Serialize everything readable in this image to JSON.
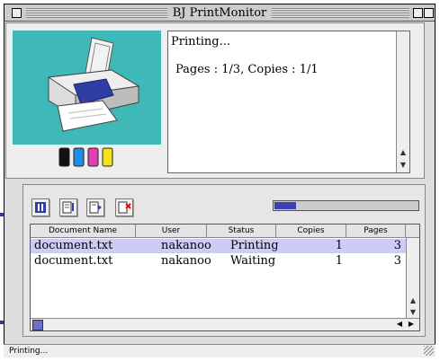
{
  "window": {
    "title": "BJ PrintMonitor"
  },
  "info": {
    "status": "Printing...",
    "detail": "Pages : 1/3, Copies : 1/1"
  },
  "ink_colors": [
    "#111111",
    "#1e8ee8",
    "#e23fb3",
    "#f4e21b"
  ],
  "toolbar": {
    "icons": [
      "pause-icon",
      "resume-icon",
      "skip-icon",
      "delete-job-icon"
    ]
  },
  "progress": {
    "fraction": 0.15
  },
  "table": {
    "columns": [
      "Document Name",
      "User",
      "Status",
      "Copies",
      "Pages"
    ],
    "rows": [
      {
        "name": "document.txt",
        "user": "nakanoo",
        "status": "Printing",
        "copies": "1",
        "pages": "3",
        "selected": true
      },
      {
        "name": "document.txt",
        "user": "nakanoo",
        "status": "Waiting",
        "copies": "1",
        "pages": "3",
        "selected": false
      }
    ]
  },
  "statusbar": {
    "text": "Printing..."
  },
  "colors": {
    "panel_teal": "#3fb8b8",
    "progress_blue": "#3b40b5",
    "selection": "#ccccf6"
  }
}
